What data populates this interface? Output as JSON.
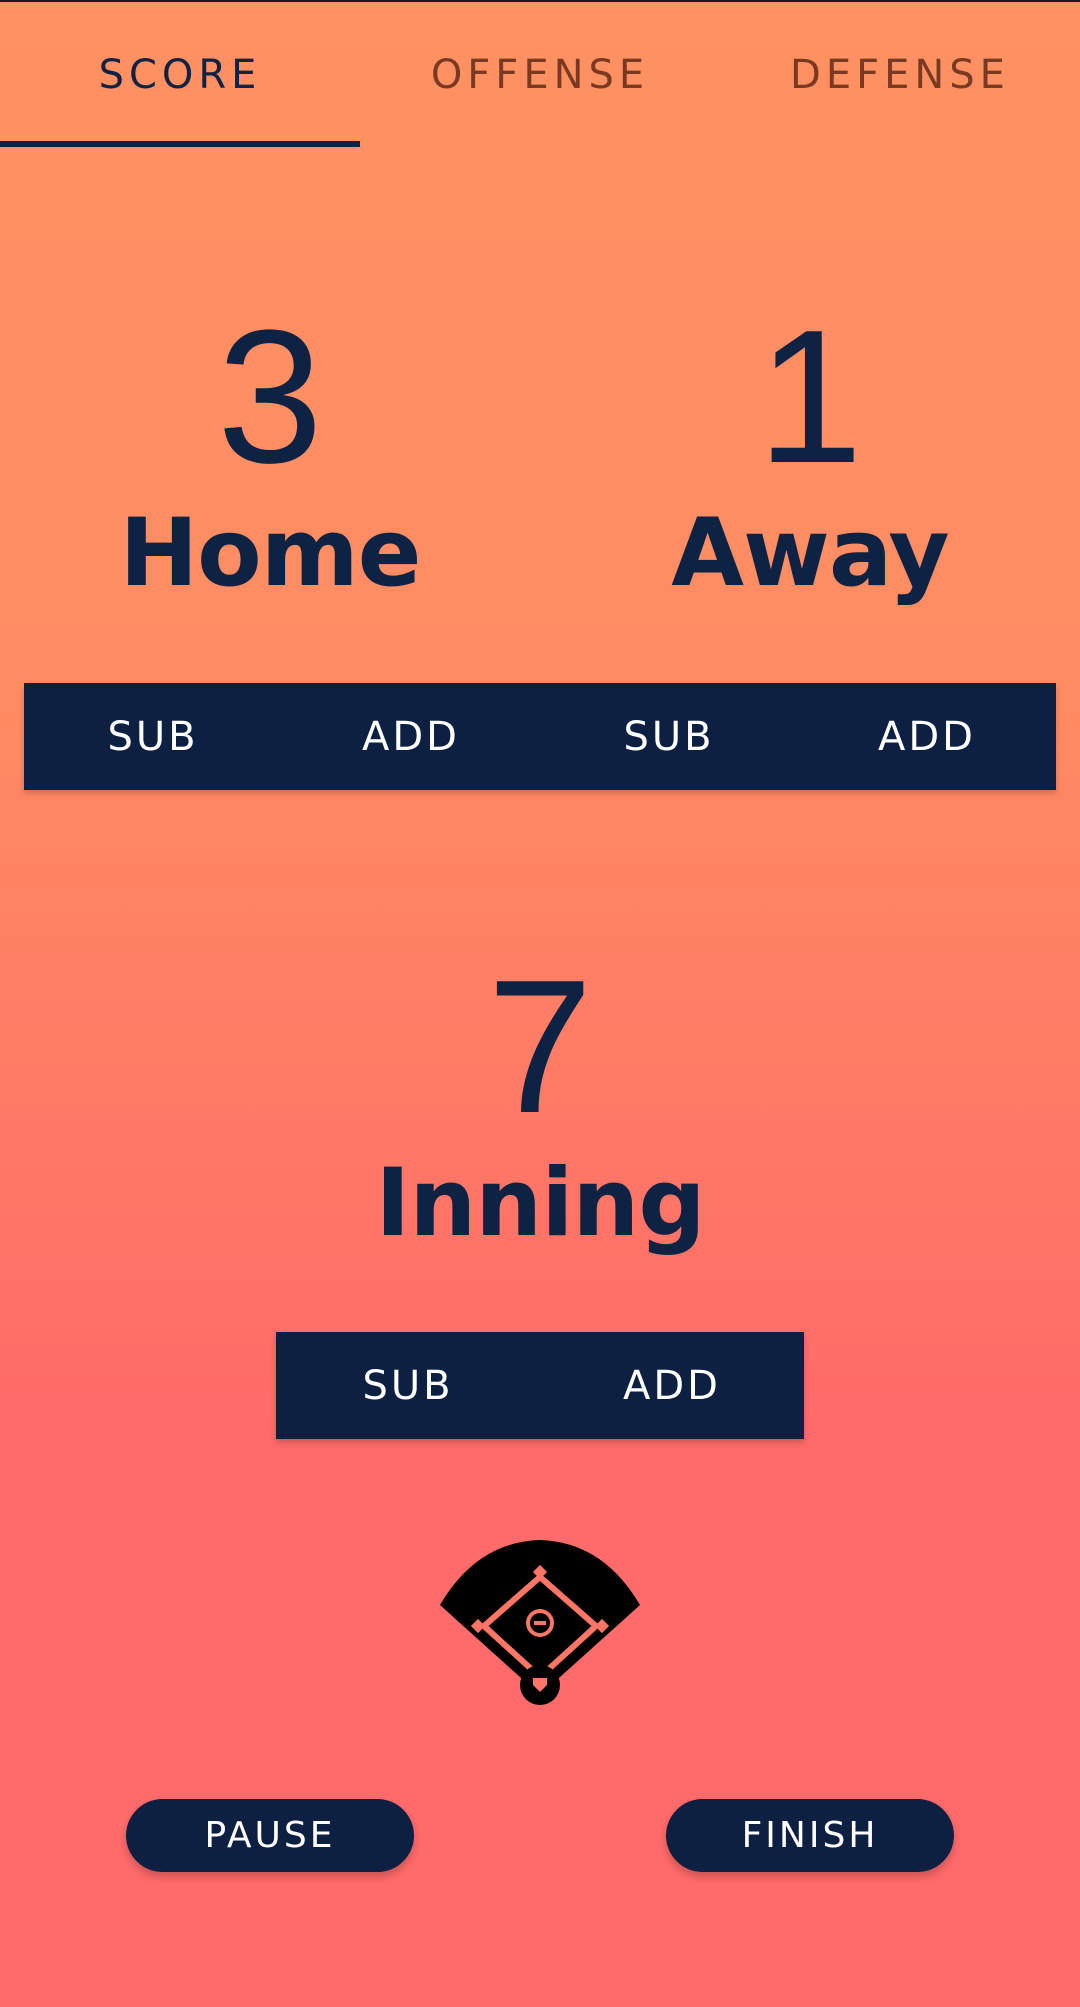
{
  "tabs": [
    {
      "label": "SCORE",
      "active": true
    },
    {
      "label": "OFFENSE",
      "active": false
    },
    {
      "label": "DEFENSE",
      "active": false
    }
  ],
  "score": {
    "home": {
      "value": "3",
      "label": "Home"
    },
    "away": {
      "value": "1",
      "label": "Away"
    }
  },
  "score_buttons": {
    "home_sub": "SUB",
    "home_add": "ADD",
    "away_sub": "SUB",
    "away_add": "ADD"
  },
  "inning": {
    "value": "7",
    "label": "Inning",
    "sub": "SUB",
    "add": "ADD"
  },
  "field_icon": "baseball-diamond-icon",
  "actions": {
    "pause": "PAUSE",
    "finish": "FINISH"
  },
  "colors": {
    "navy": "#0e2042",
    "gradient_top": "#ff9162",
    "gradient_bottom": "#ff6a6a",
    "inactive_tab": "#7a3a22"
  }
}
